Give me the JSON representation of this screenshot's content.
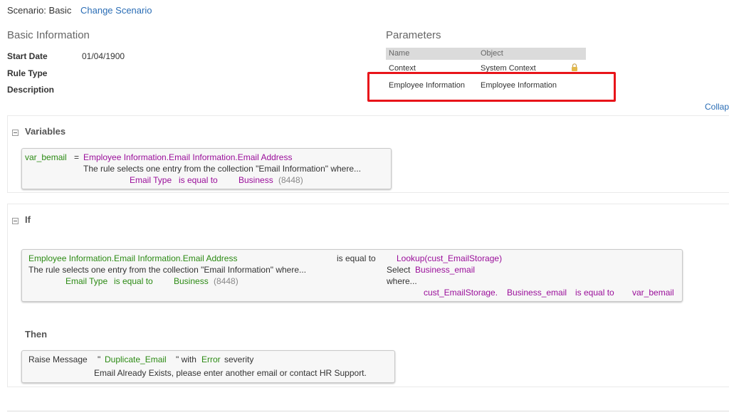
{
  "header": {
    "scenario_label": "Scenario: Basic",
    "change_scenario": "Change Scenario"
  },
  "basic_info": {
    "title": "Basic Information",
    "start_date_label": "Start Date",
    "start_date_value": "01/04/1900",
    "rule_type_label": "Rule Type",
    "description_label": "Description"
  },
  "parameters": {
    "title": "Parameters",
    "col_name": "Name",
    "col_object": "Object",
    "rows": [
      {
        "name": "Context",
        "object": "System Context",
        "locked": true
      },
      {
        "name": "Employee Information",
        "object": "Employee Information",
        "locked": false
      }
    ],
    "collapse_link": "Collap"
  },
  "variables": {
    "title": "Variables",
    "var_name": "var_bemail",
    "equals": "=",
    "expression": "Employee Information.Email Information.Email Address",
    "selects_text": "The rule selects one entry from the collection \"Email Information\" where...",
    "cond_field": "Email Type",
    "cond_op": "is equal to",
    "cond_value": "Business",
    "cond_code": "(8448)"
  },
  "if_section": {
    "title": "If",
    "left_expr": "Employee Information.Email Information.Email Address",
    "selects_text": "The rule selects one entry from the collection \"Email Information\" where...",
    "cond_field": "Email Type",
    "cond_op": "is equal to",
    "cond_value": "Business",
    "cond_code": "(8448)",
    "operator": "is equal to",
    "lookup": "Lookup(cust_EmailStorage)",
    "select_kw": "Select",
    "select_field": "Business_email",
    "where_kw": "where...",
    "where_obj": "cust_EmailStorage.",
    "where_field": "Business_email",
    "where_op": "is equal to",
    "where_value": "var_bemail"
  },
  "then_section": {
    "title": "Then",
    "raise": "Raise Message",
    "quote_open": "\"",
    "message_id": "Duplicate_Email",
    "quote_close_with": "\" with",
    "severity_value": "Error",
    "severity_word": "severity",
    "message_text": "Email Already Exists, please enter another email or contact HR Support."
  }
}
